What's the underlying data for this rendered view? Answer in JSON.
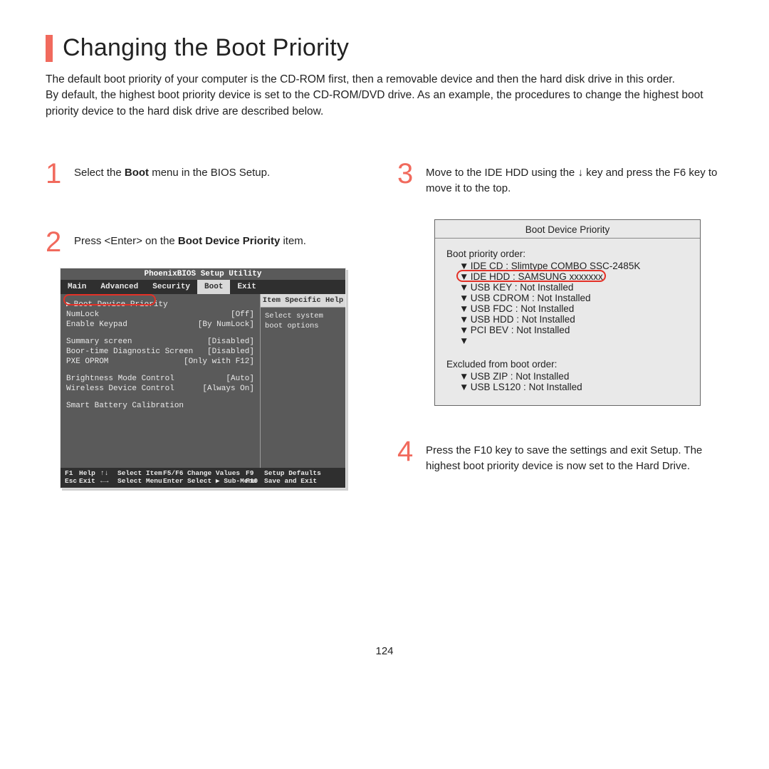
{
  "title": "Changing the Boot Priority",
  "intro": {
    "p1": "The default boot priority of your computer is the CD-ROM first, then a removable device and then the hard disk drive in this order.",
    "p2": "By default, the highest boot priority device is set to the CD-ROM/DVD drive. As an example, the procedures to change the highest boot priority device to the hard disk drive are described below."
  },
  "steps": {
    "s1": {
      "num": "1",
      "pre": "Select the ",
      "bold": "Boot",
      "post": " menu in the BIOS Setup."
    },
    "s2": {
      "num": "2",
      "pre": "Press <Enter> on the ",
      "bold": "Boot Device Priority",
      "post": " item."
    },
    "s3": {
      "num": "3",
      "pre": "Move to the IDE HDD using the ",
      "mid": "↓",
      "post": " key and press the F6 key to move it to the top."
    },
    "s4": {
      "num": "4",
      "text": "Press the F10 key to save the settings and exit Setup. The highest boot priority device is now set to the Hard Drive."
    }
  },
  "bios": {
    "header": "PhoenixBIOS Setup Utility",
    "tabs": [
      "Main",
      "Advanced",
      "Security",
      "Boot",
      "Exit"
    ],
    "selected_tab_index": 3,
    "help_head": "Item Specific Help",
    "help_body": "Select system boot options",
    "rows": [
      {
        "label": "Boot Device Priority",
        "value": "",
        "arrow": true
      },
      {
        "label": "NumLock",
        "value": "[Off]"
      },
      {
        "label": "Enable Keypad",
        "value": "[By NumLock]"
      },
      {
        "gap": true
      },
      {
        "label": "Summary screen",
        "value": "[Disabled]"
      },
      {
        "label": "Boor-time Diagnostic Screen",
        "value": "[Disabled]"
      },
      {
        "label": "PXE OPROM",
        "value": "[Only with F12]"
      },
      {
        "gap": true
      },
      {
        "label": "Brightness Mode Control",
        "value": "[Auto]"
      },
      {
        "label": "Wireless Device Control",
        "value": "[Always On]"
      },
      {
        "gap": true
      },
      {
        "label": "Smart Battery Calibration",
        "value": ""
      }
    ],
    "footer": {
      "r1": [
        "F1",
        "Help",
        "↑↓",
        "Select Item",
        "F5/F6",
        "Change Values",
        "F9",
        "Setup Defaults"
      ],
      "r2": [
        "Esc",
        "Exit",
        "←→",
        "Select Menu",
        "Enter",
        "Select ▶ Sub-Menu",
        "F10",
        "Save and Exit"
      ]
    }
  },
  "priority": {
    "title": "Boot Device Priority",
    "order_head": "Boot priority order:",
    "order": [
      "IDE CD : Slimtype COMBO SSC-2485K",
      "IDE HDD : SAMSUNG xxxxxxx",
      "USB KEY : Not Installed",
      "USB CDROM : Not Installed",
      "USB FDC : Not Installed",
      "USB HDD : Not Installed",
      "PCI BEV : Not Installed",
      ""
    ],
    "excluded_head": "Excluded from boot order:",
    "excluded": [
      "USB ZIP : Not Installed",
      "USB LS120 : Not Installed"
    ]
  },
  "page_number": "124"
}
